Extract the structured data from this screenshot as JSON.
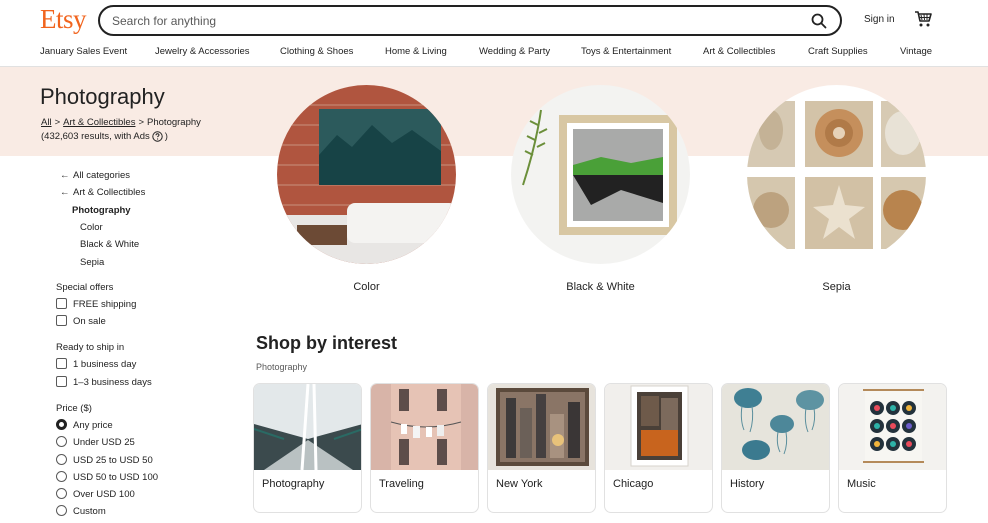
{
  "header": {
    "logo": "Etsy",
    "search_placeholder": "Search for anything",
    "signin": "Sign in"
  },
  "nav": {
    "items": [
      "January Sales Event",
      "Jewelry & Accessories",
      "Clothing & Shoes",
      "Home & Living",
      "Wedding & Party",
      "Toys & Entertainment",
      "Art & Collectibles",
      "Craft Supplies",
      "Vintage"
    ]
  },
  "banner": {
    "title": "Photography",
    "breadcrumb": [
      "All",
      "Art & Collectibles",
      "Photography"
    ],
    "breadcrumb_sep": ">",
    "results": "(432,603 results, with Ads"
  },
  "sidebar": {
    "all_categories": "All categories",
    "parent_category": "Art & Collectibles",
    "current_category": "Photography",
    "subcategories": [
      "Color",
      "Black & White",
      "Sepia"
    ],
    "special_offers": {
      "title": "Special offers",
      "options": [
        "FREE shipping",
        "On sale"
      ]
    },
    "ready_to_ship": {
      "title": "Ready to ship in",
      "options": [
        "1 business day",
        "1–3 business days"
      ]
    },
    "price": {
      "title": "Price ($)",
      "options": [
        "Any price",
        "Under USD 25",
        "USD 25 to USD 50",
        "USD 50 to USD 100",
        "Over USD 100",
        "Custom"
      ],
      "selected": "Any price"
    }
  },
  "categories": [
    {
      "label": "Color"
    },
    {
      "label": "Black & White"
    },
    {
      "label": "Sepia"
    }
  ],
  "shop_by_interest": {
    "title": "Shop by interest",
    "subtitle": "Photography",
    "cards": [
      "Photography",
      "Traveling",
      "New York",
      "Chicago",
      "History",
      "Music"
    ]
  },
  "colors": {
    "brand": "#f1641e",
    "banner_bg": "#f9ebe4",
    "text": "#222222"
  }
}
